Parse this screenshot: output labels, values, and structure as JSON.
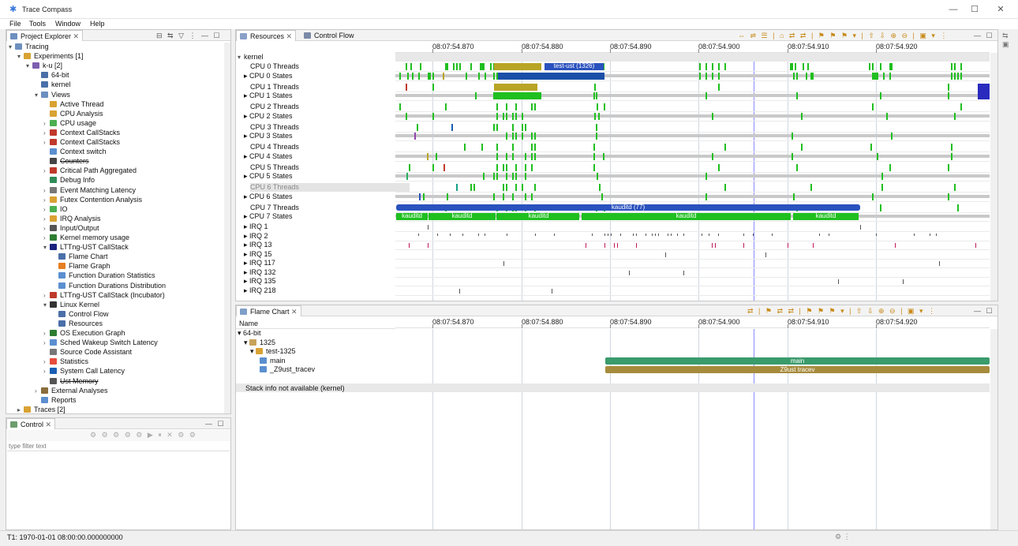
{
  "app": {
    "title": "Trace Compass"
  },
  "menu": [
    "File",
    "Tools",
    "Window",
    "Help"
  ],
  "project_explorer": {
    "tab_label": "Project Explorer",
    "items": [
      {
        "label": "Tracing"
      },
      {
        "label": "Experiments [1]"
      },
      {
        "label": "k-u [2]"
      },
      {
        "label": "64-bit"
      },
      {
        "label": "kernel"
      },
      {
        "label": "Views"
      },
      {
        "label": "Active Thread"
      },
      {
        "label": "CPU Analysis"
      },
      {
        "label": "CPU usage"
      },
      {
        "label": "Context CallStacks"
      },
      {
        "label": "Context CallStacks"
      },
      {
        "label": "Context switch"
      },
      {
        "label": "Counters"
      },
      {
        "label": "Critical Path Aggregated"
      },
      {
        "label": "Debug Info"
      },
      {
        "label": "Event Matching Latency"
      },
      {
        "label": "Futex Contention Analysis"
      },
      {
        "label": "IO"
      },
      {
        "label": "IRQ Analysis"
      },
      {
        "label": "Input/Output"
      },
      {
        "label": "Kernel memory usage"
      },
      {
        "label": "LTTng-UST CallStack"
      },
      {
        "label": "Flame Chart"
      },
      {
        "label": "Flame Graph"
      },
      {
        "label": "Function Duration Statistics"
      },
      {
        "label": "Function Durations Distribution"
      },
      {
        "label": "LTTng-UST CallStack (Incubator)"
      },
      {
        "label": "Linux Kernel"
      },
      {
        "label": "Control Flow"
      },
      {
        "label": "Resources"
      },
      {
        "label": "OS Execution Graph"
      },
      {
        "label": "Sched Wakeup Switch Latency"
      },
      {
        "label": "Source Code Assistant"
      },
      {
        "label": "Statistics"
      },
      {
        "label": "System Call Latency"
      },
      {
        "label": "Ust Memory"
      },
      {
        "label": "External Analyses"
      },
      {
        "label": "Reports"
      },
      {
        "label": "Traces [2]"
      }
    ]
  },
  "control": {
    "tab_label": "Control",
    "filter_placeholder": "type filter text"
  },
  "resources": {
    "tab_label": "Resources",
    "tab2_label": "Control Flow",
    "group": "kernel",
    "time_labels": [
      "08:07:54.870",
      "08:07:54.880",
      "08:07:54.890",
      "08:07:54.900",
      "08:07:54.910",
      "08:07:54.920"
    ],
    "rows": [
      "CPU 0 Threads",
      "CPU 0 States",
      "CPU 1 Threads",
      "CPU 1 States",
      "CPU 2 Threads",
      "CPU 2 States",
      "CPU 3 Threads",
      "CPU 3 States",
      "CPU 4 Threads",
      "CPU 4 States",
      "CPU 5 Threads",
      "CPU 5 States",
      "CPU 6 Threads",
      "CPU 6 States",
      "CPU 7 Threads",
      "CPU 7 States",
      "IRQ 1",
      "IRQ 2",
      "IRQ 13",
      "IRQ 15",
      "IRQ 117",
      "IRQ 132",
      "IRQ 135",
      "IRQ 218"
    ],
    "labels": {
      "cpu0_thread": "test-ust (1326)",
      "cpu7_thread": "kauditd (77)",
      "cpu7_state": "kauditd"
    },
    "colors": {
      "running": "#1fbf1f",
      "thread": "#2a52be",
      "ust": "#b8a526"
    }
  },
  "flame_chart": {
    "tab_label": "Flame Chart",
    "name_header": "Name",
    "time_labels": [
      "08:07:54.870",
      "08:07:54.880",
      "08:07:54.890",
      "08:07:54.900",
      "08:07:54.910",
      "08:07:54.920"
    ],
    "rows": [
      "64-bit",
      "1325",
      "test-1325",
      "main",
      "_Z9ust_tracev"
    ],
    "bars": {
      "main": "main",
      "tracev": "Z9ust tracev"
    },
    "message": "Stack info not available (kernel)",
    "colors": {
      "main": "#3a9b6b",
      "tracev": "#a68b3c"
    }
  },
  "status": {
    "text": "T1: 1970-01-01 08:00:00.000000000"
  }
}
